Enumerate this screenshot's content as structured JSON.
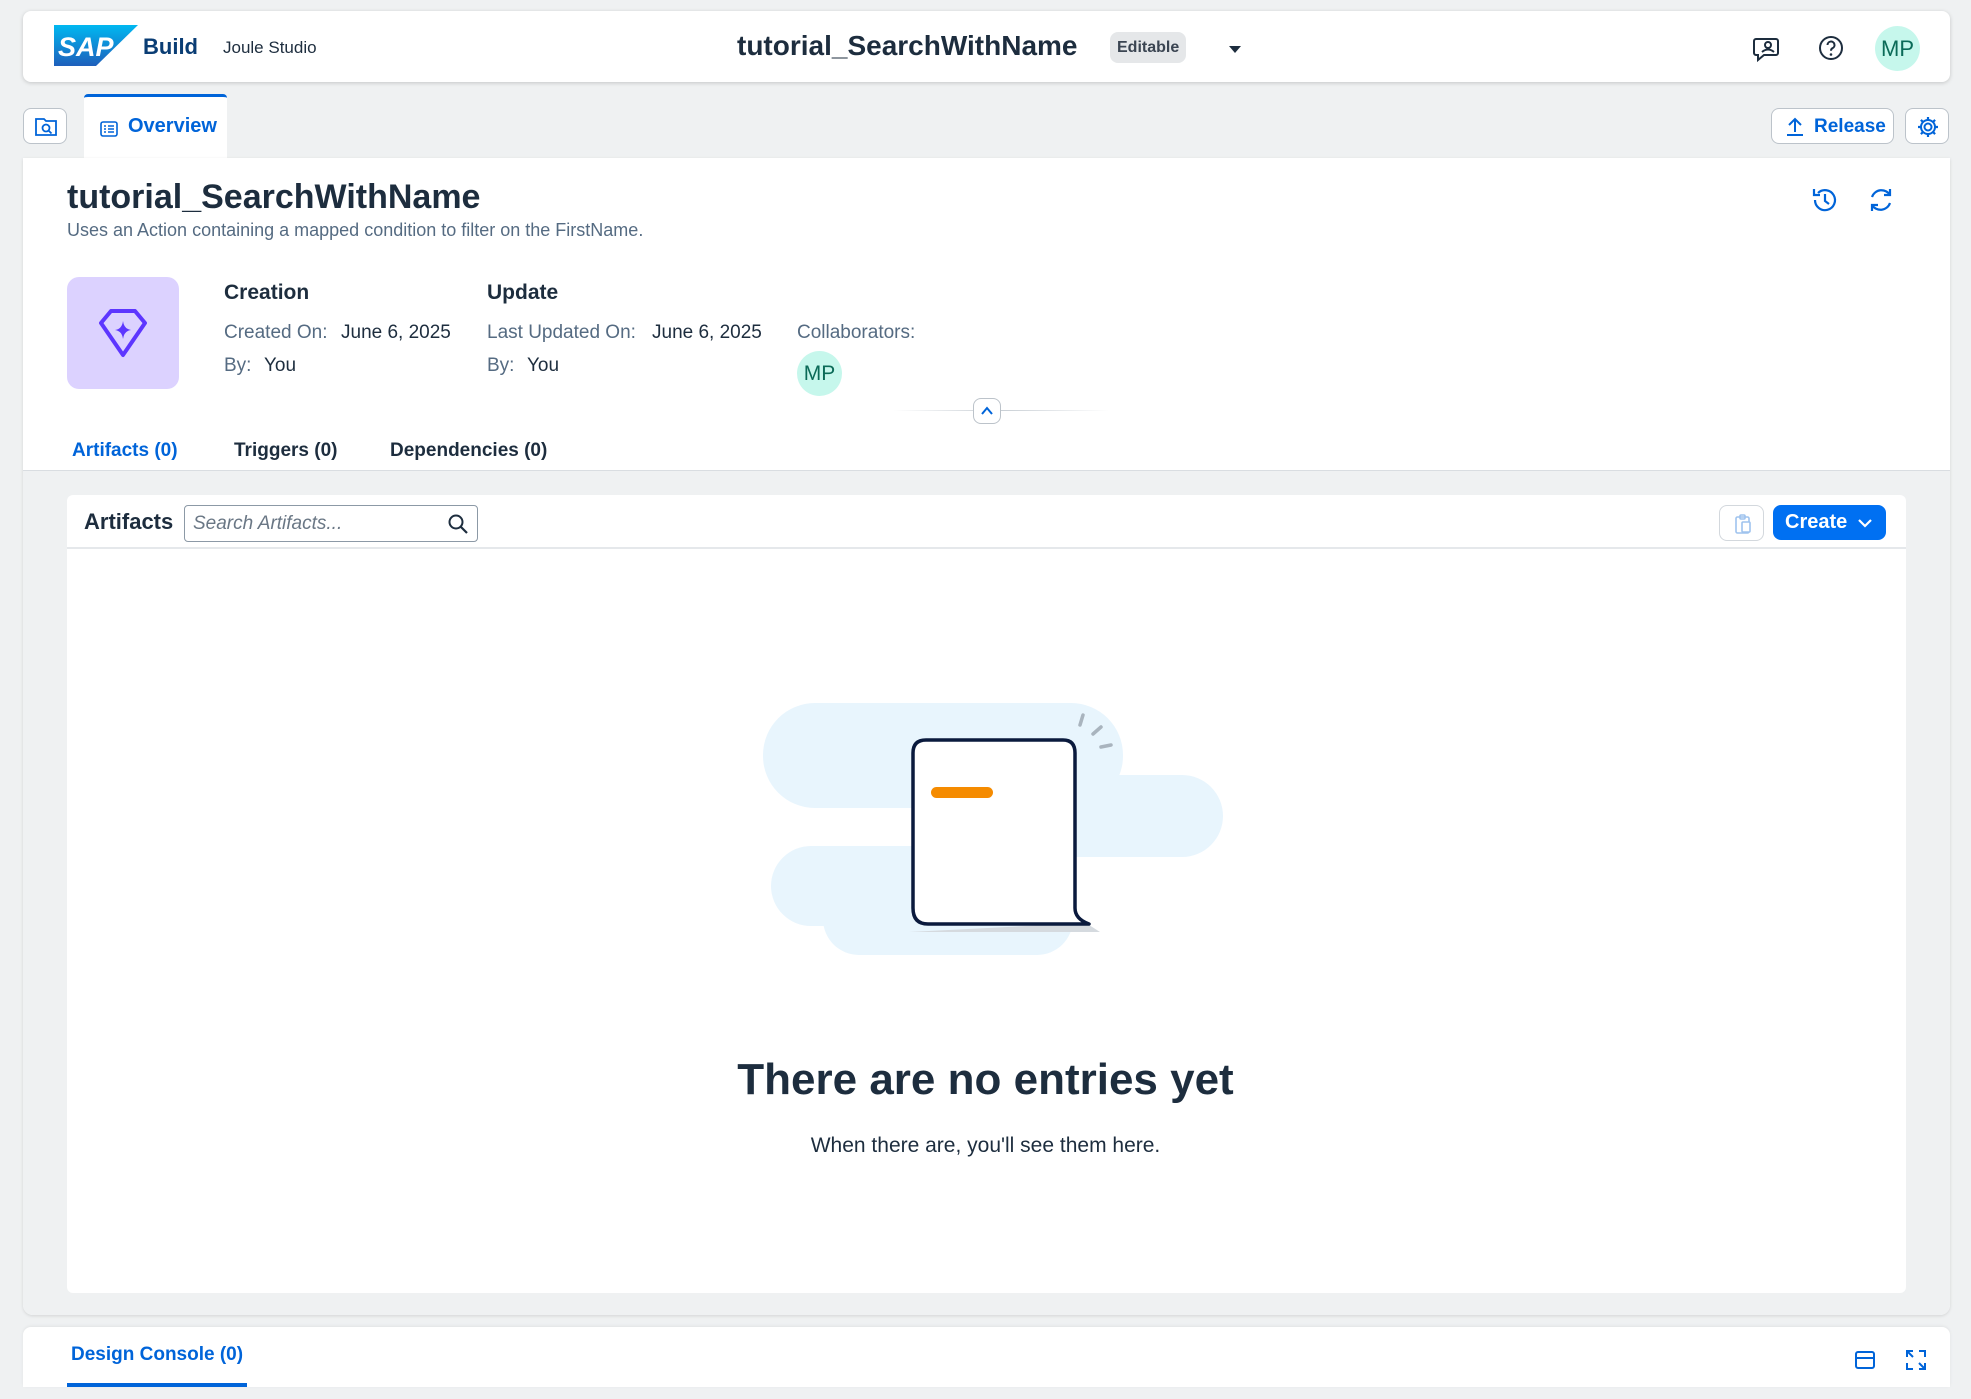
{
  "shell": {
    "brand": "Build",
    "product": "Joule Studio",
    "title": "tutorial_SearchWithName",
    "status_badge": "Editable",
    "avatar_initials": "MP"
  },
  "tabs": {
    "overview": "Overview",
    "release": "Release"
  },
  "header": {
    "title": "tutorial_SearchWithName",
    "subtitle": "Uses an Action containing a mapped condition to filter on the FirstName."
  },
  "meta": {
    "creation_heading": "Creation",
    "created_on_label": "Created On:",
    "created_on_value": "June 6, 2025",
    "created_by_label": "By:",
    "created_by_value": "You",
    "update_heading": "Update",
    "updated_on_label": "Last Updated On:",
    "updated_on_value": "June 6, 2025",
    "updated_by_label": "By:",
    "updated_by_value": "You",
    "collaborators_label": "Collaborators:",
    "collaborator_initials": "MP"
  },
  "subtabs": [
    {
      "label": "Artifacts (0)",
      "active": true
    },
    {
      "label": "Triggers (0)",
      "active": false
    },
    {
      "label": "Dependencies (0)",
      "active": false
    }
  ],
  "artifacts": {
    "title": "Artifacts",
    "search_placeholder": "Search Artifacts...",
    "create_label": "Create"
  },
  "empty_state": {
    "title": "There are no entries yet",
    "subtitle": "When there are, you'll see them here."
  },
  "console": {
    "tab_label": "Design Console (0)"
  },
  "colors": {
    "accent": "#0064d9",
    "create_button": "#0070f2",
    "avatar_bg": "#c6f7ec",
    "project_icon_bg": "#dcd2ff",
    "illustration_accent": "#f58b00"
  },
  "icons": {
    "logo": "sap-logo",
    "shell": [
      "caret-down-icon",
      "joule-chat-icon",
      "help-icon"
    ],
    "toolbar": [
      "search-project-icon",
      "overview-tab-icon",
      "upload-icon",
      "settings-icon"
    ],
    "header": [
      "history-icon",
      "refresh-icon"
    ],
    "project": "diamond-sparkle-icon",
    "console": [
      "dock-panel-icon",
      "fullscreen-icon"
    ]
  }
}
